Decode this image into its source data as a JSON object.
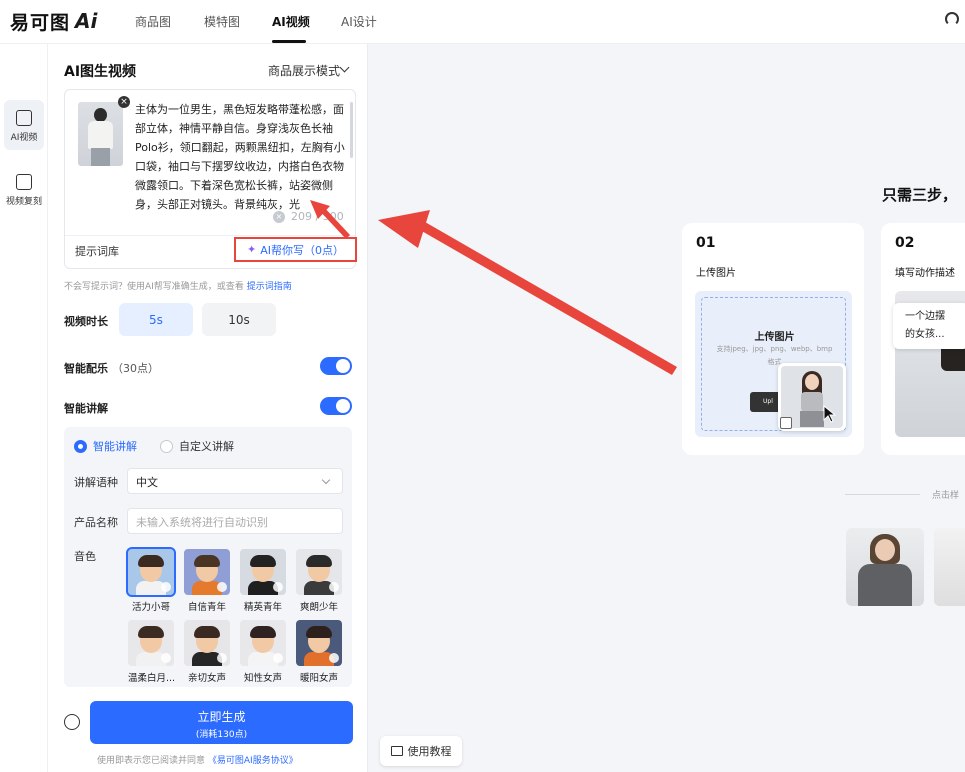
{
  "header": {
    "logo_text": "易可图",
    "logo_ai": "Ai",
    "tabs": [
      {
        "label": "商品图"
      },
      {
        "label": "模特图"
      },
      {
        "label": "AI视频"
      },
      {
        "label": "AI设计"
      }
    ],
    "active_tab": "AI视频"
  },
  "rail": {
    "items": [
      {
        "label": "AI视频",
        "icon": "image-video-icon"
      },
      {
        "label": "视频复刻",
        "icon": "video-copy-icon"
      }
    ]
  },
  "panel": {
    "title": "AI图生视频",
    "mode_select": "商品展示模式",
    "prompt": {
      "text": "主体为一位男生，黑色短发略带蓬松感，面部立体，神情平静自信。身穿浅灰色长袖Polo衫，领口翻起，两颗黑纽扣，左胸有小口袋，袖口与下摆罗纹收边，内搭白色衣物微露领口。下着深色宽松长裤，站姿微侧身，头部正对镜头。背景纯灰，光",
      "char_count": "209 / 500",
      "library_label": "提示词库",
      "ai_write_label": "AI帮你写（0点）"
    },
    "hint_text": "不会写提示词？使用AI帮写准确生成，或查看",
    "hint_link": "提示词指南",
    "duration": {
      "label": "视频时长",
      "options": [
        "5s",
        "10s"
      ],
      "selected": "5s"
    },
    "music": {
      "label": "智能配乐",
      "cost": "（30点）",
      "enabled": true
    },
    "narration": {
      "label": "智能讲解",
      "enabled": true,
      "mode_smart": "智能讲解",
      "mode_custom": "自定义讲解",
      "selected_mode": "智能讲解",
      "language_label": "讲解语种",
      "language_value": "中文",
      "product_label": "产品名称",
      "product_placeholder": "未输入系统将进行自动识别",
      "voice_label": "音色",
      "voices": [
        {
          "name": "活力小哥",
          "selected": true,
          "hair": "#3a2a20",
          "shirt": "#f2f2f2",
          "bg": "#a9c7e8"
        },
        {
          "name": "自信青年",
          "selected": false,
          "hair": "#4a3424",
          "shirt": "#e67a2c",
          "bg": "#8f9fd6"
        },
        {
          "name": "精英青年",
          "selected": false,
          "hair": "#222222",
          "shirt": "#1f1f1f",
          "bg": "#d6dbe2"
        },
        {
          "name": "爽朗少年",
          "selected": false,
          "hair": "#2a2a2a",
          "shirt": "#3b3b3b",
          "bg": "#e4e6ea"
        },
        {
          "name": "温柔白月...",
          "selected": false,
          "hair": "#3b2b22",
          "shirt": "#f1f1f1",
          "bg": "#e8e8ea"
        },
        {
          "name": "亲切女声",
          "selected": false,
          "hair": "#3a2a22",
          "shirt": "#262626",
          "bg": "#e6e6e8"
        },
        {
          "name": "知性女声",
          "selected": false,
          "hair": "#2e2320",
          "shirt": "#f4f4f4",
          "bg": "#e8e8ea"
        },
        {
          "name": "暖阳女声",
          "selected": false,
          "hair": "#2c211c",
          "shirt": "#e0702c",
          "bg": "#4b5a7a"
        }
      ]
    },
    "generate": {
      "label": "立即生成",
      "cost": "(消耗130点)"
    },
    "agreement_text": "使用即表示您已阅读并同意",
    "agreement_link": "《易可图AI服务协议》"
  },
  "canvas": {
    "headline": "只需三步，",
    "steps": [
      {
        "num": "01",
        "title": "上传图片"
      },
      {
        "num": "02",
        "title": "填写动作描述"
      }
    ],
    "upload": {
      "title": "上传图片",
      "subtitle": "支持jpeg、jpg、png、webp、bmp格式",
      "button": "Upl"
    },
    "card2_tip": [
      "一个边摆",
      "的女孩..."
    ],
    "divider_text": "点击样",
    "tutorial": "使用教程"
  },
  "colors": {
    "accent": "#2c6bff",
    "annotation_red": "#e8453c"
  }
}
